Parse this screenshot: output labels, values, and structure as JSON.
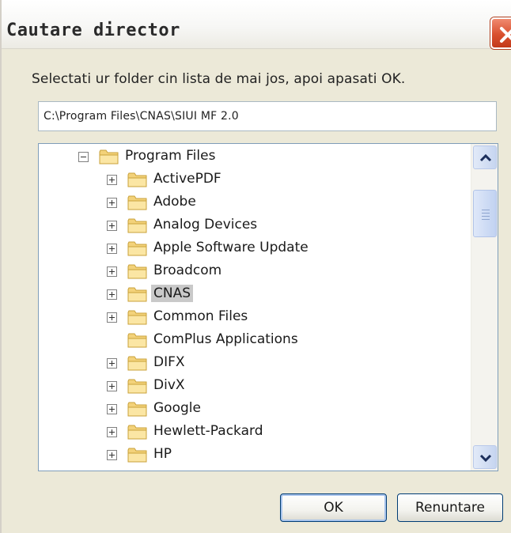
{
  "window": {
    "title": "Cautare director",
    "close_icon": "close-icon",
    "accent_color": "#d9502e"
  },
  "prompt": "Selectati ur folder cin lista de mai jos, apoi apasati OK.",
  "path": "C:\\Program Files\\CNAS\\SIUI MF 2.0",
  "tree": {
    "items": [
      {
        "label": "Program Files",
        "expander": "minus",
        "level": 0
      },
      {
        "label": "ActivePDF",
        "expander": "plus",
        "level": 1
      },
      {
        "label": "Adobe",
        "expander": "plus",
        "level": 1
      },
      {
        "label": "Analog Devices",
        "expander": "plus",
        "level": 1
      },
      {
        "label": "Apple Software Update",
        "expander": "plus",
        "level": 1
      },
      {
        "label": "Broadcom",
        "expander": "plus",
        "level": 1
      },
      {
        "label": "CNAS",
        "expander": "plus",
        "level": 1,
        "selected": true
      },
      {
        "label": "Common Files",
        "expander": "plus",
        "level": 1
      },
      {
        "label": "ComPlus Applications",
        "expander": "none",
        "level": 1
      },
      {
        "label": "DIFX",
        "expander": "plus",
        "level": 1
      },
      {
        "label": "DivX",
        "expander": "plus",
        "level": 1
      },
      {
        "label": "Google",
        "expander": "plus",
        "level": 1
      },
      {
        "label": "Hewlett-Packard",
        "expander": "plus",
        "level": 1
      },
      {
        "label": "HP",
        "expander": "plus",
        "level": 1
      }
    ],
    "folder_icon": "folder-icon",
    "selected_color": "#c9c9c9"
  },
  "buttons": {
    "ok_label": "OK",
    "cancel_label": "Renuntare"
  }
}
